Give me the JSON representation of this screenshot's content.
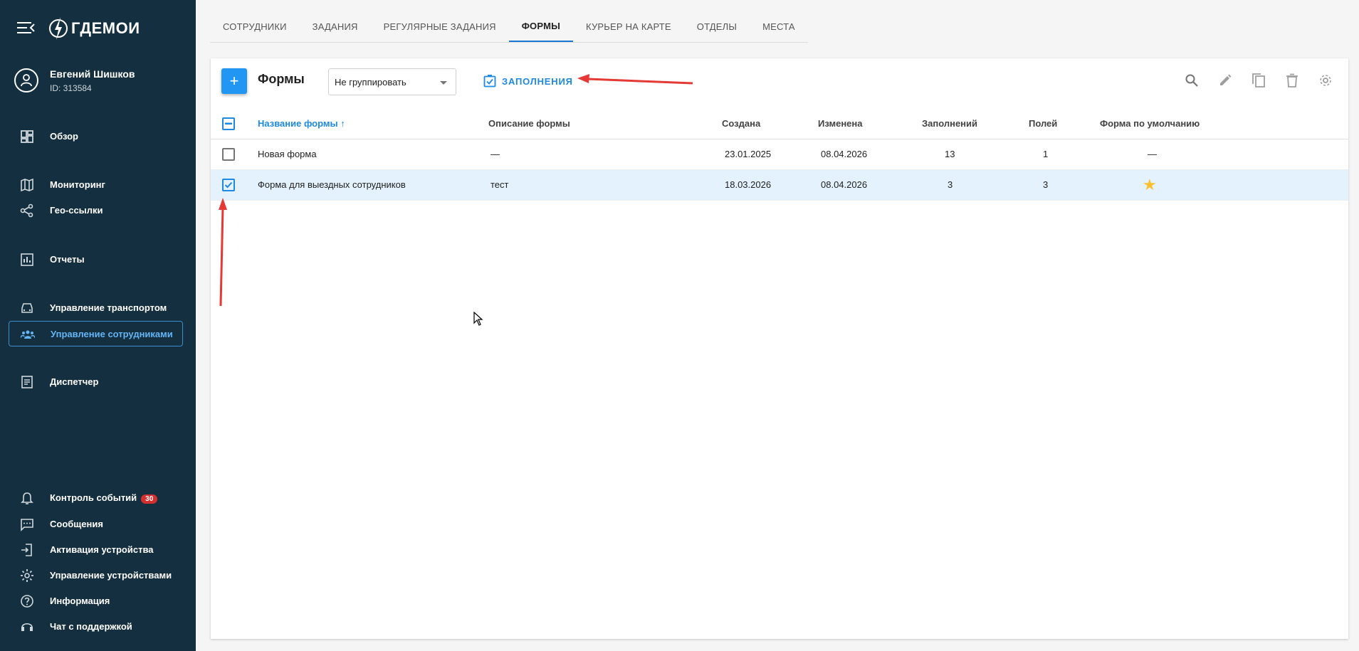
{
  "app": {
    "logo_text": "ГДЕМОИ",
    "user": {
      "name": "Евгений Шишков",
      "id_text": "ID: 313584"
    }
  },
  "sidebar": {
    "items": [
      {
        "label": "Обзор",
        "icon": "dashboard-icon"
      },
      {
        "label": "Мониторинг",
        "icon": "map-icon"
      },
      {
        "label": "Гео-ссылки",
        "icon": "share-icon"
      },
      {
        "label": "Отчеты",
        "icon": "chart-icon"
      },
      {
        "label": "Управление транспортом",
        "icon": "car-icon"
      },
      {
        "label": "Управление сотрудниками",
        "icon": "people-icon",
        "active": true
      },
      {
        "label": "Диспетчер",
        "icon": "dispatcher-icon"
      }
    ],
    "bottom_items": [
      {
        "label": "Контроль событий",
        "icon": "bell-icon",
        "badge": "30"
      },
      {
        "label": "Сообщения",
        "icon": "message-icon"
      },
      {
        "label": "Активация устройства",
        "icon": "device-activation-icon"
      },
      {
        "label": "Управление устройствами",
        "icon": "gear-icon"
      },
      {
        "label": "Информация",
        "icon": "help-icon"
      },
      {
        "label": "Чат с поддержкой",
        "icon": "support-chat-icon"
      }
    ]
  },
  "tabs": [
    {
      "label": "Сотрудники"
    },
    {
      "label": "Задания"
    },
    {
      "label": "Регулярные задания"
    },
    {
      "label": "Формы",
      "active": true
    },
    {
      "label": "Курьер на карте"
    },
    {
      "label": "Отделы"
    },
    {
      "label": "Места"
    }
  ],
  "forms_page": {
    "add_button": "+",
    "title": "Формы",
    "group_select": {
      "value": "Не группировать"
    },
    "fillings_button": "Заполнения",
    "toolbar_icons": [
      "search-icon",
      "edit-icon",
      "copy-icon",
      "delete-icon",
      "settings-icon"
    ],
    "columns": [
      "Название формы",
      "Описание формы",
      "Создана",
      "Изменена",
      "Заполнений",
      "Полей",
      "Форма по умолчанию"
    ],
    "sort_indicator": "↑",
    "rows": [
      {
        "name": "Новая форма",
        "description": "—",
        "created": "23.01.2025",
        "modified": "08.04.2026",
        "fillings": "13",
        "fields": "1",
        "default": "—",
        "selected": false
      },
      {
        "name": "Форма для выездных сотрудников",
        "description": "тест",
        "created": "18.03.2026",
        "modified": "08.04.2026",
        "fillings": "3",
        "fields": "3",
        "default": "★",
        "selected": true
      }
    ]
  },
  "colors": {
    "sidebar_bg": "#142f3f",
    "accent": "#1e88e5",
    "star": "#fbc02d",
    "annotation": "#e53935"
  }
}
